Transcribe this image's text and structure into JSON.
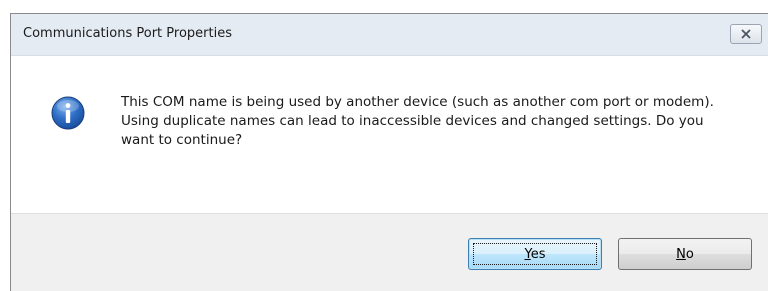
{
  "window": {
    "title": "Communications Port Properties"
  },
  "message": {
    "text": "This COM name is being used by another device (such as another com port or modem).  Using duplicate names can lead to inaccessible devices and changed settings.  Do you want to continue?"
  },
  "buttons": {
    "yes": {
      "mnemonic": "Y",
      "rest": "es"
    },
    "no": {
      "mnemonic": "N",
      "rest": "o"
    }
  },
  "icons": {
    "info": "information-icon",
    "close": "close-icon"
  },
  "colors": {
    "info_blue": "#1f5fb8",
    "default_button_border": "#3c7fb1"
  }
}
